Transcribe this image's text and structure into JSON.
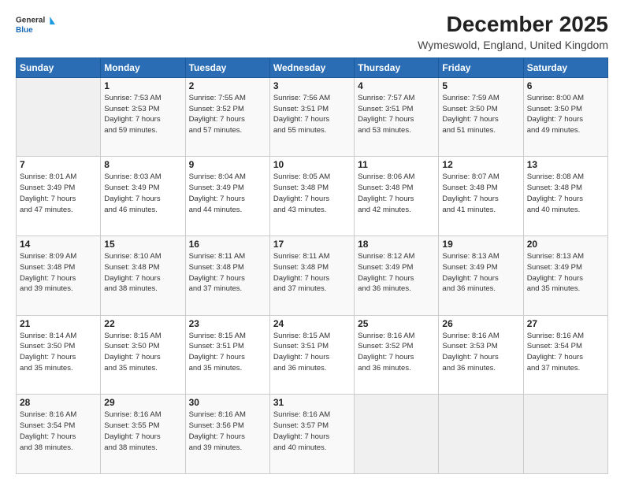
{
  "logo": {
    "line1": "General",
    "line2": "Blue"
  },
  "header": {
    "title": "December 2025",
    "subtitle": "Wymeswold, England, United Kingdom"
  },
  "calendar": {
    "days_of_week": [
      "Sunday",
      "Monday",
      "Tuesday",
      "Wednesday",
      "Thursday",
      "Friday",
      "Saturday"
    ],
    "weeks": [
      [
        {
          "day": "",
          "info": ""
        },
        {
          "day": "1",
          "info": "Sunrise: 7:53 AM\nSunset: 3:53 PM\nDaylight: 7 hours\nand 59 minutes."
        },
        {
          "day": "2",
          "info": "Sunrise: 7:55 AM\nSunset: 3:52 PM\nDaylight: 7 hours\nand 57 minutes."
        },
        {
          "day": "3",
          "info": "Sunrise: 7:56 AM\nSunset: 3:51 PM\nDaylight: 7 hours\nand 55 minutes."
        },
        {
          "day": "4",
          "info": "Sunrise: 7:57 AM\nSunset: 3:51 PM\nDaylight: 7 hours\nand 53 minutes."
        },
        {
          "day": "5",
          "info": "Sunrise: 7:59 AM\nSunset: 3:50 PM\nDaylight: 7 hours\nand 51 minutes."
        },
        {
          "day": "6",
          "info": "Sunrise: 8:00 AM\nSunset: 3:50 PM\nDaylight: 7 hours\nand 49 minutes."
        }
      ],
      [
        {
          "day": "7",
          "info": "Sunrise: 8:01 AM\nSunset: 3:49 PM\nDaylight: 7 hours\nand 47 minutes."
        },
        {
          "day": "8",
          "info": "Sunrise: 8:03 AM\nSunset: 3:49 PM\nDaylight: 7 hours\nand 46 minutes."
        },
        {
          "day": "9",
          "info": "Sunrise: 8:04 AM\nSunset: 3:49 PM\nDaylight: 7 hours\nand 44 minutes."
        },
        {
          "day": "10",
          "info": "Sunrise: 8:05 AM\nSunset: 3:48 PM\nDaylight: 7 hours\nand 43 minutes."
        },
        {
          "day": "11",
          "info": "Sunrise: 8:06 AM\nSunset: 3:48 PM\nDaylight: 7 hours\nand 42 minutes."
        },
        {
          "day": "12",
          "info": "Sunrise: 8:07 AM\nSunset: 3:48 PM\nDaylight: 7 hours\nand 41 minutes."
        },
        {
          "day": "13",
          "info": "Sunrise: 8:08 AM\nSunset: 3:48 PM\nDaylight: 7 hours\nand 40 minutes."
        }
      ],
      [
        {
          "day": "14",
          "info": "Sunrise: 8:09 AM\nSunset: 3:48 PM\nDaylight: 7 hours\nand 39 minutes."
        },
        {
          "day": "15",
          "info": "Sunrise: 8:10 AM\nSunset: 3:48 PM\nDaylight: 7 hours\nand 38 minutes."
        },
        {
          "day": "16",
          "info": "Sunrise: 8:11 AM\nSunset: 3:48 PM\nDaylight: 7 hours\nand 37 minutes."
        },
        {
          "day": "17",
          "info": "Sunrise: 8:11 AM\nSunset: 3:48 PM\nDaylight: 7 hours\nand 37 minutes."
        },
        {
          "day": "18",
          "info": "Sunrise: 8:12 AM\nSunset: 3:49 PM\nDaylight: 7 hours\nand 36 minutes."
        },
        {
          "day": "19",
          "info": "Sunrise: 8:13 AM\nSunset: 3:49 PM\nDaylight: 7 hours\nand 36 minutes."
        },
        {
          "day": "20",
          "info": "Sunrise: 8:13 AM\nSunset: 3:49 PM\nDaylight: 7 hours\nand 35 minutes."
        }
      ],
      [
        {
          "day": "21",
          "info": "Sunrise: 8:14 AM\nSunset: 3:50 PM\nDaylight: 7 hours\nand 35 minutes."
        },
        {
          "day": "22",
          "info": "Sunrise: 8:15 AM\nSunset: 3:50 PM\nDaylight: 7 hours\nand 35 minutes."
        },
        {
          "day": "23",
          "info": "Sunrise: 8:15 AM\nSunset: 3:51 PM\nDaylight: 7 hours\nand 35 minutes."
        },
        {
          "day": "24",
          "info": "Sunrise: 8:15 AM\nSunset: 3:51 PM\nDaylight: 7 hours\nand 36 minutes."
        },
        {
          "day": "25",
          "info": "Sunrise: 8:16 AM\nSunset: 3:52 PM\nDaylight: 7 hours\nand 36 minutes."
        },
        {
          "day": "26",
          "info": "Sunrise: 8:16 AM\nSunset: 3:53 PM\nDaylight: 7 hours\nand 36 minutes."
        },
        {
          "day": "27",
          "info": "Sunrise: 8:16 AM\nSunset: 3:54 PM\nDaylight: 7 hours\nand 37 minutes."
        }
      ],
      [
        {
          "day": "28",
          "info": "Sunrise: 8:16 AM\nSunset: 3:54 PM\nDaylight: 7 hours\nand 38 minutes."
        },
        {
          "day": "29",
          "info": "Sunrise: 8:16 AM\nSunset: 3:55 PM\nDaylight: 7 hours\nand 38 minutes."
        },
        {
          "day": "30",
          "info": "Sunrise: 8:16 AM\nSunset: 3:56 PM\nDaylight: 7 hours\nand 39 minutes."
        },
        {
          "day": "31",
          "info": "Sunrise: 8:16 AM\nSunset: 3:57 PM\nDaylight: 7 hours\nand 40 minutes."
        },
        {
          "day": "",
          "info": ""
        },
        {
          "day": "",
          "info": ""
        },
        {
          "day": "",
          "info": ""
        }
      ]
    ]
  }
}
